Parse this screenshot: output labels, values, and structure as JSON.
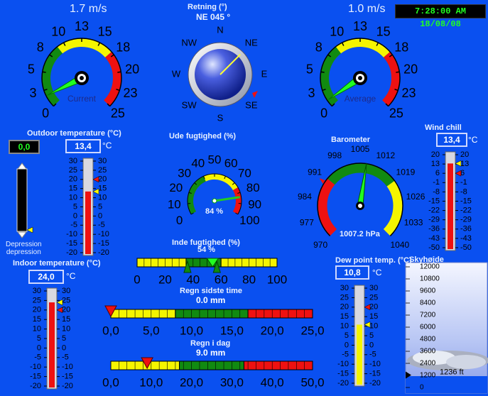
{
  "clock": "7:28:00 AM 18/08/08",
  "wind": {
    "current_speed": "1.7 m/s",
    "average_speed": "1.0 m/s",
    "current_label": "Current",
    "average_label": "Average",
    "current_value": 1.7,
    "average_value": 1.0,
    "ticks": [
      "0",
      "3",
      "5",
      "8",
      "10",
      "13",
      "15",
      "18",
      "20",
      "23",
      "25"
    ],
    "max": 25
  },
  "compass": {
    "title": "Retning (°)",
    "reading": "NE  045 °",
    "direction_deg": 45,
    "points": [
      "N",
      "NE",
      "E",
      "SE",
      "S",
      "SW",
      "W",
      "NW"
    ]
  },
  "outdoor_temp": {
    "title": "Outdoor temperature (°C)",
    "value": "13,4",
    "unit": "°C",
    "level": 13.4,
    "scale": [
      "30",
      "25",
      "20",
      "15",
      "10",
      "5",
      "0",
      "-5",
      "-10",
      "-15",
      "-20"
    ]
  },
  "depression": {
    "value": "0,0",
    "label": "Depression\ndepression",
    "level": 0
  },
  "indoor_temp": {
    "title": "Indoor temperature (°C)",
    "value": "24,0",
    "unit": "°C",
    "level": 24.0,
    "scale": [
      "30",
      "25",
      "20",
      "15",
      "10",
      "5",
      "0",
      "-5",
      "-10",
      "-15",
      "-20"
    ]
  },
  "humidity_out": {
    "title": "Ude fugtighed (%)",
    "value": "84 %",
    "level": 84,
    "ticks": [
      "0",
      "10",
      "20",
      "30",
      "40",
      "50",
      "60",
      "70",
      "80",
      "90",
      "100"
    ]
  },
  "humidity_in": {
    "title": "Inde fugtighed (%)",
    "value": "54 %",
    "level": 54,
    "ticks": [
      "0",
      "20",
      "40",
      "60",
      "80",
      "100"
    ]
  },
  "barometer": {
    "title": "Barometer",
    "value": "1007.2 hPa",
    "level": 1007.2,
    "ticks": [
      "970",
      "977",
      "984",
      "991",
      "998",
      "1005",
      "1012",
      "1019",
      "1026",
      "1033",
      "1040"
    ]
  },
  "wind_chill": {
    "title": "Wind chill",
    "value": "13,4",
    "unit": "°C",
    "level": 13.4,
    "scale": [
      "20",
      "13",
      "6",
      "-1",
      "-8",
      "-15",
      "-22",
      "-29",
      "-36",
      "-43",
      "-50"
    ]
  },
  "dew_point": {
    "title": "Dew point temp. (°C)",
    "value": "10,8",
    "unit": "°C",
    "level": 10.8,
    "scale": [
      "30",
      "25",
      "20",
      "15",
      "10",
      "5",
      "0",
      "-5",
      "-10",
      "-15",
      "-20"
    ]
  },
  "rain_last": {
    "title": "Regn sidste time",
    "value": "0.0 mm",
    "level": 0.0,
    "ticks": [
      "0,0",
      "5,0",
      "10,0",
      "15,0",
      "20,0",
      "25,0"
    ],
    "max": 25
  },
  "rain_today": {
    "title": "Regn i dag",
    "value": "9.0 mm",
    "level": 9.0,
    "ticks": [
      "0,0",
      "10,0",
      "20,0",
      "30,0",
      "40,0",
      "50,0"
    ],
    "max": 50
  },
  "cloud_base": {
    "title": "Skyhøjde",
    "value": "1236 ft",
    "level": 1236,
    "scale": [
      "12000",
      "10800",
      "9600",
      "8400",
      "7200",
      "6000",
      "4800",
      "3600",
      "2400",
      "1200",
      "0"
    ]
  }
}
